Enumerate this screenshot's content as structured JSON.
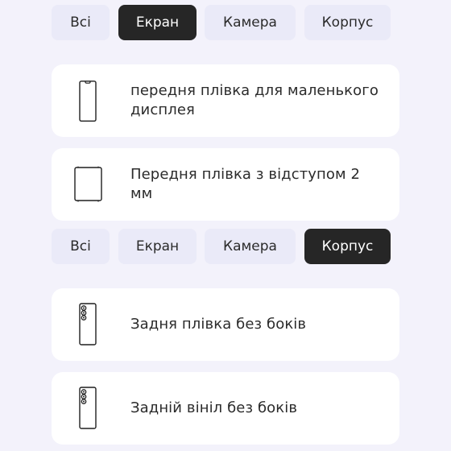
{
  "section1": {
    "tabs": [
      {
        "label": "Всі",
        "active": false
      },
      {
        "label": "Екран",
        "active": true
      },
      {
        "label": "Камера",
        "active": false
      },
      {
        "label": "Корпус",
        "active": false
      }
    ],
    "items": [
      {
        "label": "передня плівка для маленького дисплея",
        "icon": "phone-front-notch-icon"
      },
      {
        "label": "Передня плівка з відступом 2 мм",
        "icon": "phone-front-bordered-icon"
      }
    ]
  },
  "section2": {
    "tabs": [
      {
        "label": "Всі",
        "active": false
      },
      {
        "label": "Екран",
        "active": false
      },
      {
        "label": "Камера",
        "active": false
      },
      {
        "label": "Корпус",
        "active": true
      }
    ],
    "items": [
      {
        "label": "Задня плівка без боків",
        "icon": "phone-back-camera-icon"
      },
      {
        "label": "Задній вініл без боків",
        "icon": "phone-back-camera-icon"
      }
    ]
  },
  "colors": {
    "background": "#f3f2fb",
    "tab_inactive": "#eaeaf8",
    "tab_active": "#262626",
    "card": "#ffffff"
  }
}
